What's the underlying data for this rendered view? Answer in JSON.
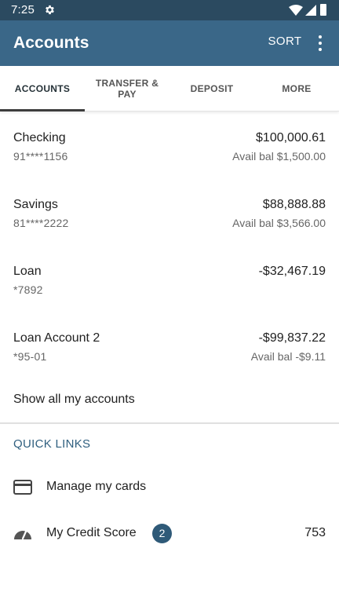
{
  "status_bar": {
    "time": "7:25",
    "icons": [
      "gear-icon",
      "wifi-icon",
      "signal-icon",
      "battery-icon"
    ]
  },
  "app_bar": {
    "title": "Accounts",
    "sort_label": "SORT",
    "menu_icon": "more-vert-icon"
  },
  "tabs": [
    {
      "label": "ACCOUNTS",
      "active": true
    },
    {
      "label": "TRANSFER & PAY",
      "active": false
    },
    {
      "label": "DEPOSIT",
      "active": false
    },
    {
      "label": "MORE",
      "active": false
    }
  ],
  "accounts": [
    {
      "name": "Checking",
      "number": "91****1156",
      "balance": "$100,000.61",
      "available": "Avail bal $1,500.00"
    },
    {
      "name": "Savings",
      "number": "81****2222",
      "balance": "$88,888.88",
      "available": "Avail bal $3,566.00"
    },
    {
      "name": "Loan",
      "number": "*7892",
      "balance": "-$32,467.19",
      "available": ""
    },
    {
      "name": "Loan Account 2",
      "number": "*95-01",
      "balance": "-$99,837.22",
      "available": "Avail bal -$9.11"
    }
  ],
  "show_all_label": "Show all my accounts",
  "quick_links": {
    "title": "QUICK LINKS",
    "items": [
      {
        "label": "Manage my cards",
        "icon": "credit-card-icon"
      },
      {
        "label": "My Credit Score",
        "icon": "speedometer-icon",
        "badge": "2",
        "value": "753"
      }
    ]
  },
  "colors": {
    "status_bar": "#2b4a60",
    "app_bar": "#3a6788",
    "accent": "#2f5f7f",
    "badge": "#2f5a78"
  }
}
